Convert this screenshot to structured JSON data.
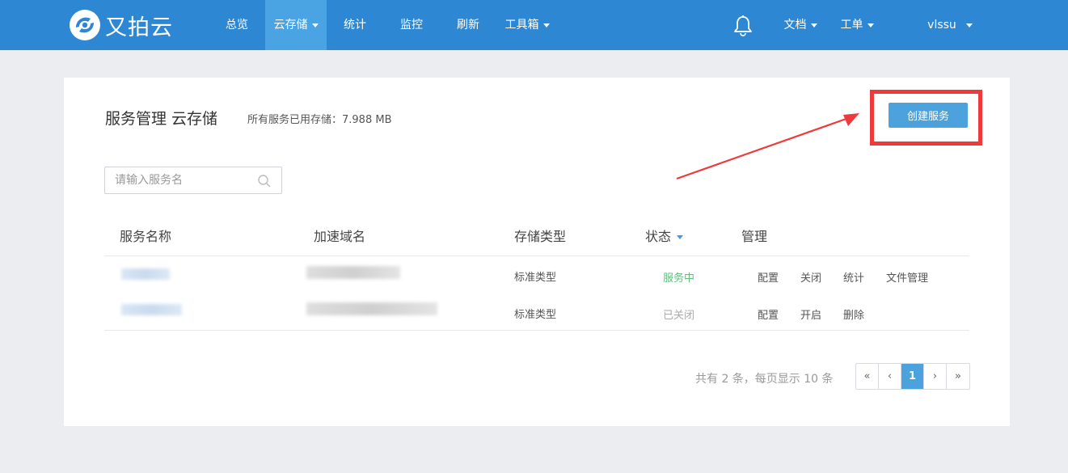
{
  "brand": {
    "name": "又拍云"
  },
  "nav": {
    "items": [
      {
        "label": "总览"
      },
      {
        "label": "云存储"
      },
      {
        "label": "统计"
      },
      {
        "label": "监控"
      },
      {
        "label": "刷新"
      },
      {
        "label": "工具箱"
      }
    ],
    "right": [
      {
        "label": "文档"
      },
      {
        "label": "工单"
      }
    ],
    "user": "vlssu"
  },
  "page": {
    "title": "服务管理 云存储",
    "storage_summary": "所有服务已用存储：7.988 MB",
    "create_label": "创建服务"
  },
  "search": {
    "placeholder": "请输入服务名"
  },
  "table": {
    "columns": [
      "服务名称",
      "加速域名",
      "存储类型",
      "状态",
      "管理"
    ],
    "rows": [
      {
        "type": "标准类型",
        "status": "服务中",
        "actions": [
          "配置",
          "关闭",
          "统计",
          "文件管理"
        ]
      },
      {
        "type": "标准类型",
        "status": "已关闭",
        "actions": [
          "配置",
          "开启",
          "删除"
        ]
      }
    ]
  },
  "pagination": {
    "summary": "共有 2 条，每页显示 10 条",
    "first": "«",
    "prev": "‹",
    "current": "1",
    "next": "›",
    "last": "»"
  },
  "colors": {
    "nav_bg": "#2d87d3",
    "nav_active": "#4aa3e3",
    "primary": "#4ba2dc",
    "highlight": "#ee3a3a",
    "status_on": "#5fbf7f"
  },
  "icons": [
    "logo-icon",
    "bell-icon",
    "search-icon",
    "chevron-down-icon",
    "sort-caret-icon"
  ]
}
